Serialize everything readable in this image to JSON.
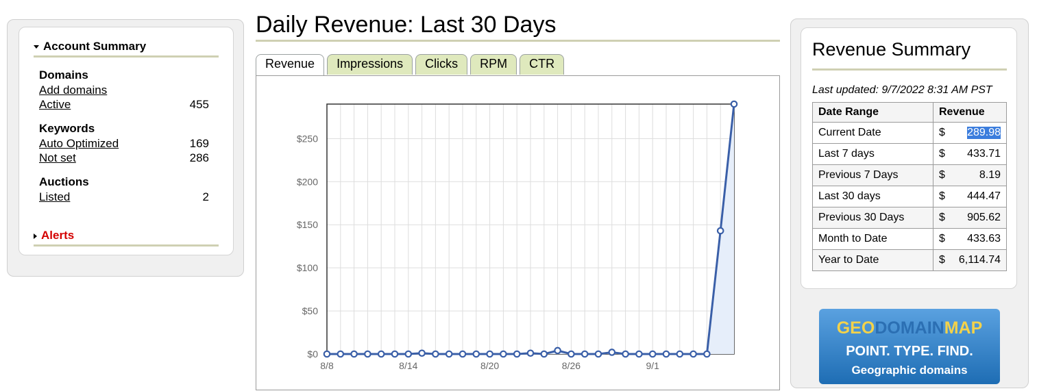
{
  "summary": {
    "heading": "Account Summary",
    "groups": [
      {
        "title": "Domains",
        "rows": [
          {
            "label": "Add domains",
            "value": ""
          },
          {
            "label": "Active",
            "value": "455"
          }
        ]
      },
      {
        "title": "Keywords",
        "rows": [
          {
            "label": "Auto Optimized",
            "value": "169"
          },
          {
            "label": "Not set",
            "value": "286"
          }
        ]
      },
      {
        "title": "Auctions",
        "rows": [
          {
            "label": "Listed",
            "value": "2"
          }
        ]
      }
    ],
    "alerts": "Alerts"
  },
  "page": {
    "title": "Daily Revenue: Last 30 Days"
  },
  "tabs": [
    "Revenue",
    "Impressions",
    "Clicks",
    "RPM",
    "CTR"
  ],
  "active_tab": "Revenue",
  "chart_data": {
    "type": "area",
    "x": [
      "8/8",
      "8/9",
      "8/10",
      "8/11",
      "8/12",
      "8/13",
      "8/14",
      "8/15",
      "8/16",
      "8/17",
      "8/18",
      "8/19",
      "8/20",
      "8/21",
      "8/22",
      "8/23",
      "8/24",
      "8/25",
      "8/26",
      "8/27",
      "8/28",
      "8/29",
      "8/30",
      "8/31",
      "9/1",
      "9/2",
      "9/3",
      "9/4",
      "9/5",
      "9/6",
      "9/7"
    ],
    "series": [
      {
        "values": [
          0,
          0,
          0,
          0,
          0,
          0,
          0,
          1,
          0,
          0,
          0,
          0,
          0,
          0,
          0,
          1,
          0,
          4,
          0,
          0,
          0,
          2,
          0,
          0,
          0,
          0,
          0,
          0,
          0,
          143,
          289.98
        ]
      }
    ],
    "x_tick_labels": [
      "8/8",
      "8/14",
      "8/20",
      "8/26",
      "9/1"
    ],
    "y_tick_labels": [
      "$0",
      "$50",
      "$100",
      "$150",
      "$200",
      "$250"
    ],
    "ylim": [
      0,
      290
    ],
    "grid": true,
    "colors": {
      "line": "#3a5fa8",
      "fill": "#e6eefa",
      "grid": "#dddddd"
    }
  },
  "revenue_summary": {
    "title": "Revenue Summary",
    "last_updated": "Last updated: 9/7/2022 8:31 AM PST",
    "col_range": "Date Range",
    "col_revenue": "Revenue",
    "currency": "$",
    "rows": [
      {
        "range": "Current Date",
        "value": "289.98"
      },
      {
        "range": "Last 7 days",
        "value": "433.71"
      },
      {
        "range": "Previous 7 Days",
        "value": "8.19"
      },
      {
        "range": "Last 30 days",
        "value": "444.47"
      },
      {
        "range": "Previous 30 Days",
        "value": "905.62"
      },
      {
        "range": "Month to Date",
        "value": "433.63"
      },
      {
        "range": "Year to Date",
        "value": "6,114.74"
      }
    ]
  },
  "banner": {
    "logo_geo": "GEO",
    "logo_domain": "DOMAIN",
    "logo_map": "MAP",
    "tagline": "POINT. TYPE. FIND.",
    "subline": "Geographic domains"
  }
}
